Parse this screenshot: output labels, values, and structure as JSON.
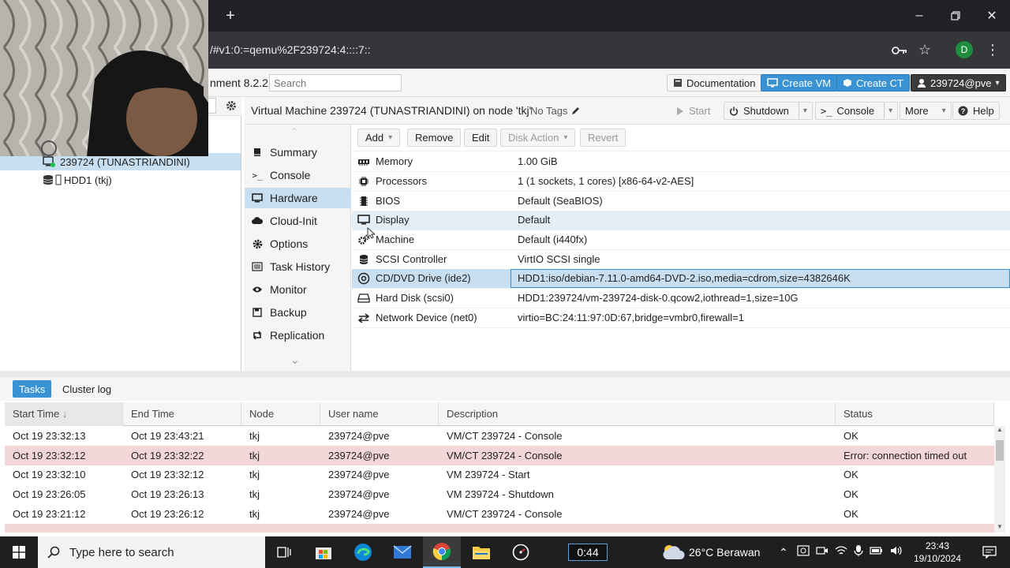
{
  "browser": {
    "url_fragment": "/#v1:0:=qemu%2F239724:4::::7::",
    "profile_initial": "D"
  },
  "pve": {
    "version_text": "nment 8.2.2",
    "search_placeholder": "Search",
    "header_buttons": {
      "documentation": "Documentation",
      "create_vm": "Create VM",
      "create_ct": "Create CT",
      "user": "239724@pve"
    }
  },
  "tree": {
    "items": [
      {
        "label": "239724 (TUNASTRIANDINI)"
      },
      {
        "label": "HDD1 (tkj)"
      }
    ]
  },
  "content": {
    "title": "Virtual Machine 239724 (TUNASTRIANDINI) on node 'tkj'",
    "tags": "No Tags",
    "toolbar": {
      "start": "Start",
      "shutdown": "Shutdown",
      "console": "Console",
      "more": "More",
      "help": "Help"
    },
    "nav": [
      {
        "label": "Summary"
      },
      {
        "label": "Console"
      },
      {
        "label": "Hardware"
      },
      {
        "label": "Cloud-Init"
      },
      {
        "label": "Options"
      },
      {
        "label": "Task History"
      },
      {
        "label": "Monitor"
      },
      {
        "label": "Backup"
      },
      {
        "label": "Replication"
      }
    ],
    "hardware_toolbar": {
      "add": "Add",
      "remove": "Remove",
      "edit": "Edit",
      "disk_action": "Disk Action",
      "revert": "Revert"
    },
    "hardware": [
      {
        "label": "Memory",
        "value": "1.00 GiB"
      },
      {
        "label": "Processors",
        "value": "1 (1 sockets, 1 cores) [x86-64-v2-AES]"
      },
      {
        "label": "BIOS",
        "value": "Default (SeaBIOS)"
      },
      {
        "label": "Display",
        "value": "Default"
      },
      {
        "label": "Machine",
        "value": "Default (i440fx)"
      },
      {
        "label": "SCSI Controller",
        "value": "VirtIO SCSI single"
      },
      {
        "label": "CD/DVD Drive (ide2)",
        "value": "HDD1:iso/debian-7.11.0-amd64-DVD-2.iso,media=cdrom,size=4382646K"
      },
      {
        "label": "Hard Disk (scsi0)",
        "value": "HDD1:239724/vm-239724-disk-0.qcow2,iothread=1,size=10G"
      },
      {
        "label": "Network Device (net0)",
        "value": "virtio=BC:24:11:97:0D:67,bridge=vmbr0,firewall=1"
      }
    ]
  },
  "tasks": {
    "tabs": {
      "tasks": "Tasks",
      "cluster_log": "Cluster log"
    },
    "columns": [
      "Start Time",
      "End Time",
      "Node",
      "User name",
      "Description",
      "Status"
    ],
    "rows": [
      {
        "start": "Oct 19 23:32:13",
        "end": "Oct 19 23:43:21",
        "node": "tkj",
        "user": "239724@pve",
        "desc": "VM/CT 239724 - Console",
        "status": "OK"
      },
      {
        "start": "Oct 19 23:32:12",
        "end": "Oct 19 23:32:22",
        "node": "tkj",
        "user": "239724@pve",
        "desc": "VM/CT 239724 - Console",
        "status": "Error: connection timed out"
      },
      {
        "start": "Oct 19 23:32:10",
        "end": "Oct 19 23:32:12",
        "node": "tkj",
        "user": "239724@pve",
        "desc": "VM 239724 - Start",
        "status": "OK"
      },
      {
        "start": "Oct 19 23:26:05",
        "end": "Oct 19 23:26:13",
        "node": "tkj",
        "user": "239724@pve",
        "desc": "VM 239724 - Shutdown",
        "status": "OK"
      },
      {
        "start": "Oct 19 23:21:12",
        "end": "Oct 19 23:26:12",
        "node": "tkj",
        "user": "239724@pve",
        "desc": "VM/CT 239724 - Console",
        "status": "OK"
      }
    ]
  },
  "taskbar": {
    "search_placeholder": "Type here to search",
    "timer": "0:44",
    "weather": "26°C  Berawan",
    "time": "23:43",
    "date": "19/10/2024"
  },
  "colors": {
    "accent": "#3892d4",
    "selected": "#c7dff1",
    "error_row": "#f3d6d7"
  }
}
